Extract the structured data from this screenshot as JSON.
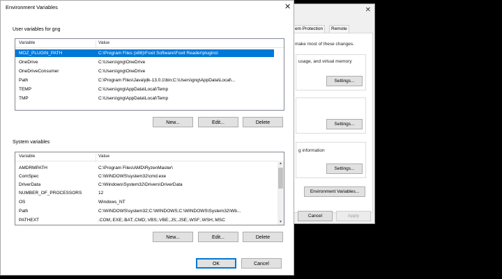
{
  "system_properties": {
    "tabs": [
      "em Protection",
      "Remote"
    ],
    "notice": "make most of these changes.",
    "performance_text": "usage, and virtual memory",
    "startup_text": "g information",
    "settings_label": "Settings...",
    "env_vars_label": "Environment Variables...",
    "cancel_label": "Cancel",
    "apply_label": "Apply"
  },
  "dialog": {
    "title": "Environment Variables",
    "close_glyph": "✕",
    "user_section_label": "User variables for gng",
    "system_section_label": "System variables",
    "col_variable": "Variable",
    "col_value": "Value",
    "user_vars": [
      {
        "name": "MOZ_PLUGIN_PATH",
        "value": "C:\\Program Files (x86)\\Foxit Software\\Foxit Reader\\plugins\\"
      },
      {
        "name": "OneDrive",
        "value": "C:\\Users\\gng\\OneDrive"
      },
      {
        "name": "OneDriveConsumer",
        "value": "C:\\Users\\gng\\OneDrive"
      },
      {
        "name": "Path",
        "value": "C:\\Program Files\\Java\\jdk-13.0.1\\bin;C:\\Users\\gng\\AppData\\Local\\..."
      },
      {
        "name": "TEMP",
        "value": "C:\\Users\\gng\\AppData\\Local\\Temp"
      },
      {
        "name": "TMP",
        "value": "C:\\Users\\gng\\AppData\\Local\\Temp"
      }
    ],
    "system_vars": [
      {
        "name": "AMDRMPATH",
        "value": "C:\\Program Files\\AMD\\RyzenMaster\\"
      },
      {
        "name": "ComSpec",
        "value": "C:\\WINDOWS\\system32\\cmd.exe"
      },
      {
        "name": "DriverData",
        "value": "C:\\Windows\\System32\\Drivers\\DriverData"
      },
      {
        "name": "NUMBER_OF_PROCESSORS",
        "value": "12"
      },
      {
        "name": "OS",
        "value": "Windows_NT"
      },
      {
        "name": "Path",
        "value": "C:\\WINDOWS\\system32;C:\\WINDOWS;C:\\WINDOWS\\System32\\Wb..."
      },
      {
        "name": "PATHEXT",
        "value": ".COM;.EXE;.BAT;.CMD;.VBS;.VBE;.JS;.JSE;.WSF;.WSH;.MSC"
      }
    ],
    "user_buttons": {
      "new": "New...",
      "edit": "Edit...",
      "delete": "Delete"
    },
    "system_buttons": {
      "new": "New...",
      "edit": "Edit...",
      "delete": "Delete"
    },
    "ok_label": "OK",
    "cancel_label": "Cancel"
  },
  "colors": {
    "selection": "#0078d7",
    "backdrop": "#000000"
  }
}
